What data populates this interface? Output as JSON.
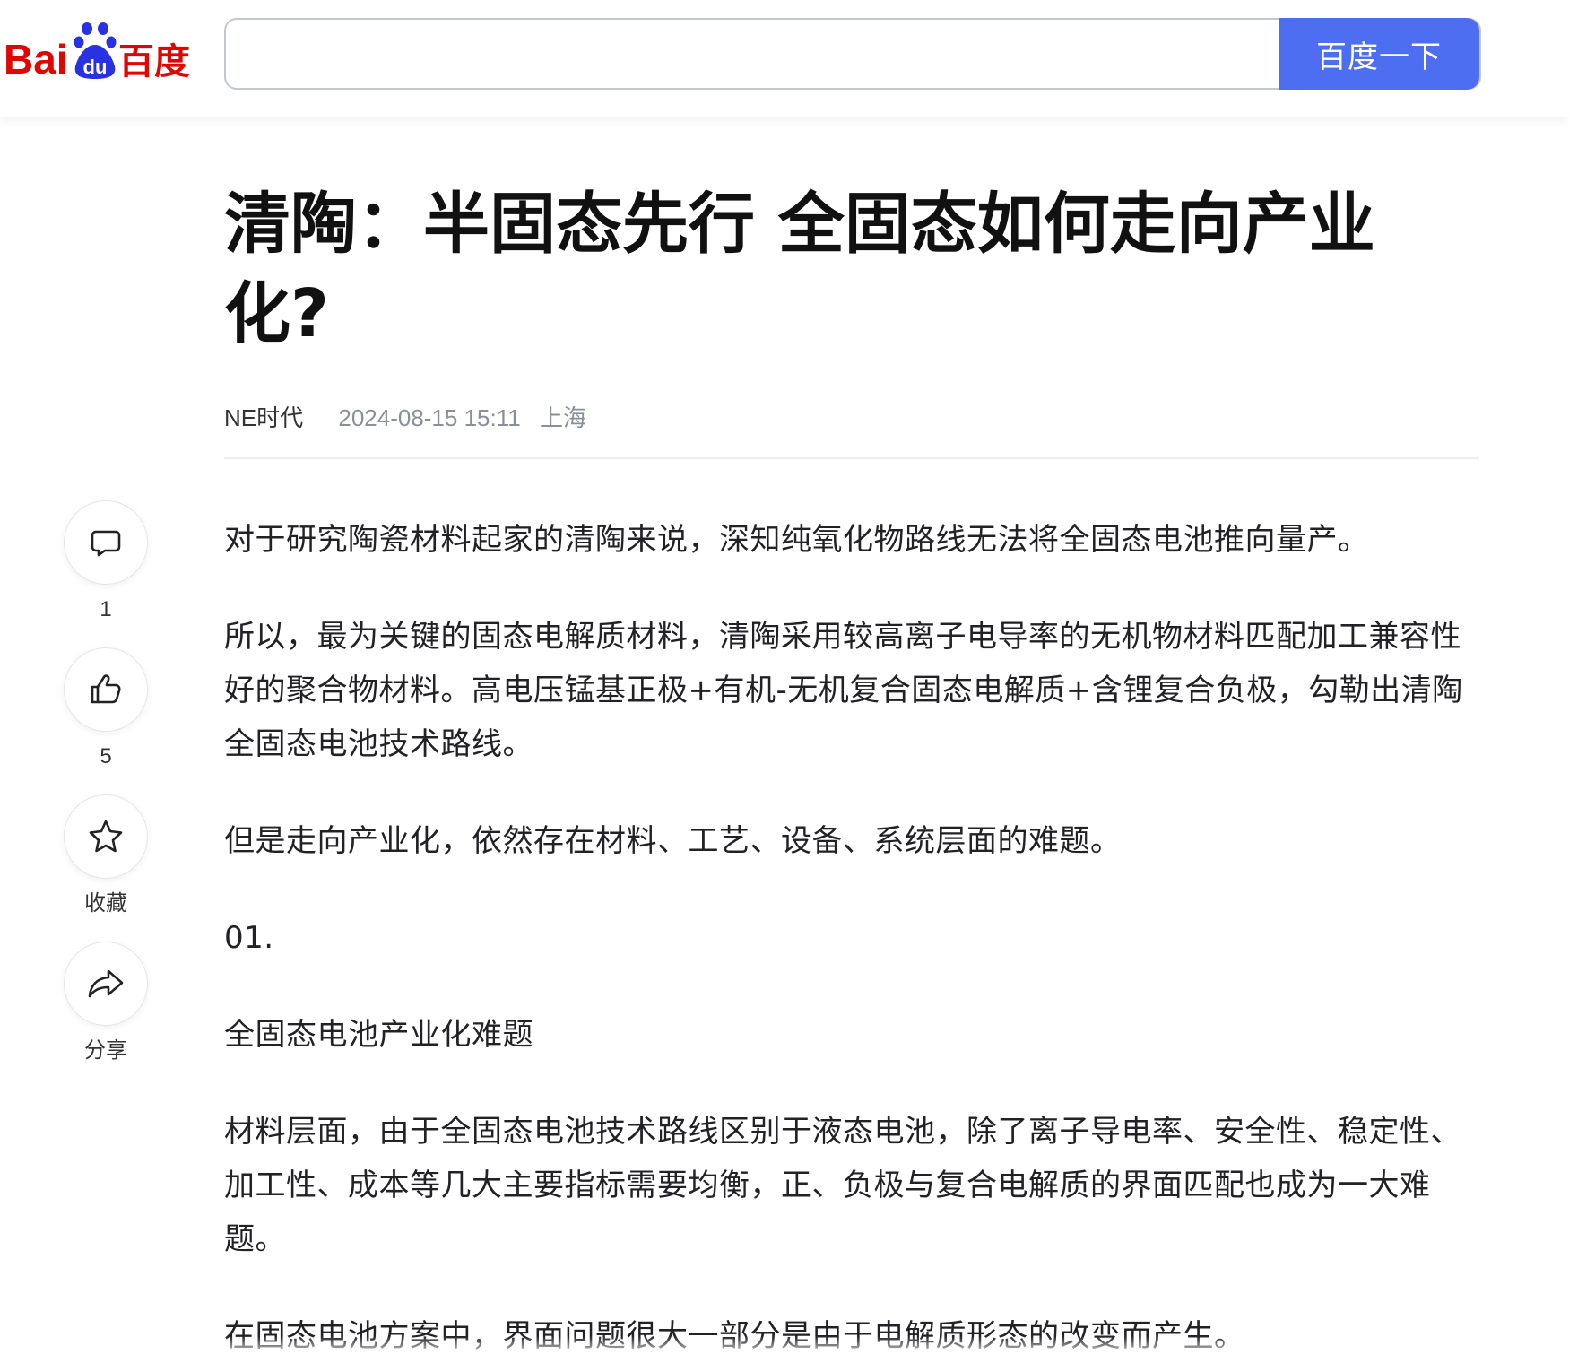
{
  "header": {
    "logo_text_en": "Bai",
    "logo_paw_text": "du",
    "logo_text_cn": "百度",
    "search_value": "",
    "search_button_label": "百度一下",
    "colors": {
      "logo_red": "#e10602",
      "logo_blue": "#2932e1",
      "button_blue": "#4e6ef2"
    }
  },
  "article": {
    "title": "清陶：半固态先行 全固态如何走向产业化?",
    "author": "NE时代",
    "datetime": "2024-08-15 15:11",
    "location": "上海",
    "paragraphs": [
      "对于研究陶瓷材料起家的清陶来说，深知纯氧化物路线无法将全固态电池推向量产。",
      "所以，最为关键的固态电解质材料，清陶采用较高离子电导率的无机物材料匹配加工兼容性好的聚合物材料。高电压锰基正极+有机-无机复合固态电解质+含锂复合负极，勾勒出清陶全固态电池技术路线。",
      "但是走向产业化，依然存在材料、工艺、设备、系统层面的难题。",
      "01.",
      "全固态电池产业化难题",
      "材料层面，由于全固态电池技术路线区别于液态电池，除了离子导电率、安全性、稳定性、加工性、成本等几大主要指标需要均衡，正、负极与复合电解质的界面匹配也成为一大难题。",
      "在固态电池方案中，界面问题很大一部分是由于电解质形态的改变而产生。"
    ]
  },
  "sidebar": {
    "comment": {
      "icon": "comment-icon",
      "count": "1"
    },
    "like": {
      "icon": "thumbs-up-icon",
      "count": "5"
    },
    "favorite": {
      "icon": "star-icon",
      "label": "收藏"
    },
    "share": {
      "icon": "share-icon",
      "label": "分享"
    }
  }
}
